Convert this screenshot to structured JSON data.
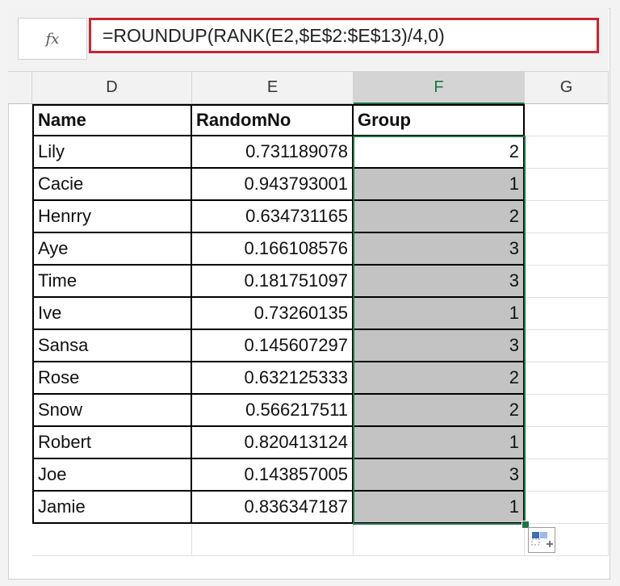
{
  "formula_bar": {
    "fx_label": "fx",
    "formula": "=ROUNDUP(RANK(E2,$E$2:$E$13)/4,0)"
  },
  "columns": [
    {
      "letter": "D"
    },
    {
      "letter": "E"
    },
    {
      "letter": "F",
      "selected": true
    },
    {
      "letter": "G"
    }
  ],
  "table": {
    "headers": [
      "Name",
      "RandomNo",
      "Group"
    ],
    "rows": [
      {
        "name": "Lily",
        "random": "0.731189078",
        "group": "2"
      },
      {
        "name": "Cacie",
        "random": "0.943793001",
        "group": "1"
      },
      {
        "name": "Henrry",
        "random": "0.634731165",
        "group": "2"
      },
      {
        "name": "Aye",
        "random": "0.166108576",
        "group": "3"
      },
      {
        "name": "Time",
        "random": "0.181751097",
        "group": "3"
      },
      {
        "name": "Ive",
        "random": "0.73260135",
        "group": "1"
      },
      {
        "name": "Sansa",
        "random": "0.145607297",
        "group": "3"
      },
      {
        "name": "Rose",
        "random": "0.632125333",
        "group": "2"
      },
      {
        "name": "Snow",
        "random": "0.566217511",
        "group": "2"
      },
      {
        "name": "Robert",
        "random": "0.820413124",
        "group": "1"
      },
      {
        "name": "Joe",
        "random": "0.143857005",
        "group": "3"
      },
      {
        "name": "Jamie",
        "random": "0.836347187",
        "group": "1"
      }
    ]
  },
  "colors": {
    "accent_green": "#217346",
    "formula_highlight": "#c8262f",
    "selected_fill": "#c3c3c3"
  }
}
